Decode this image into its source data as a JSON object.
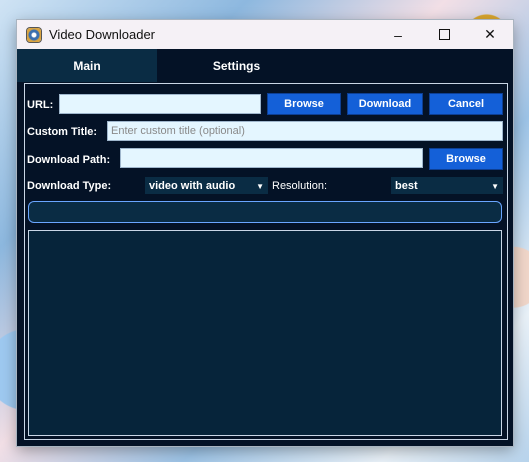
{
  "window": {
    "title": "Video Downloader",
    "controls": {
      "minimize": "–",
      "maximize": "☐",
      "close": "✕"
    }
  },
  "tabs": [
    {
      "label": "Main",
      "selected": true
    },
    {
      "label": "Settings",
      "selected": false
    }
  ],
  "form": {
    "url": {
      "label": "URL:",
      "value": ""
    },
    "buttons": {
      "browse": "Browse",
      "download": "Download",
      "cancel": "Cancel"
    },
    "custom_title": {
      "label": "Custom Title:",
      "placeholder": "Enter custom title (optional)",
      "value": ""
    },
    "download_path": {
      "label": "Download Path:",
      "value": "",
      "browse": "Browse"
    },
    "download_type": {
      "label": "Download Type:",
      "value": "video with audio"
    },
    "resolution": {
      "label": "Resolution:",
      "value": "best"
    }
  },
  "progress": {
    "value": 0
  },
  "log": {
    "text": ""
  },
  "colors": {
    "button": "#1460d8",
    "panel_bg": "#041226",
    "tab_selected": "#0a2c44",
    "input_bg": "#e4f6ff"
  }
}
